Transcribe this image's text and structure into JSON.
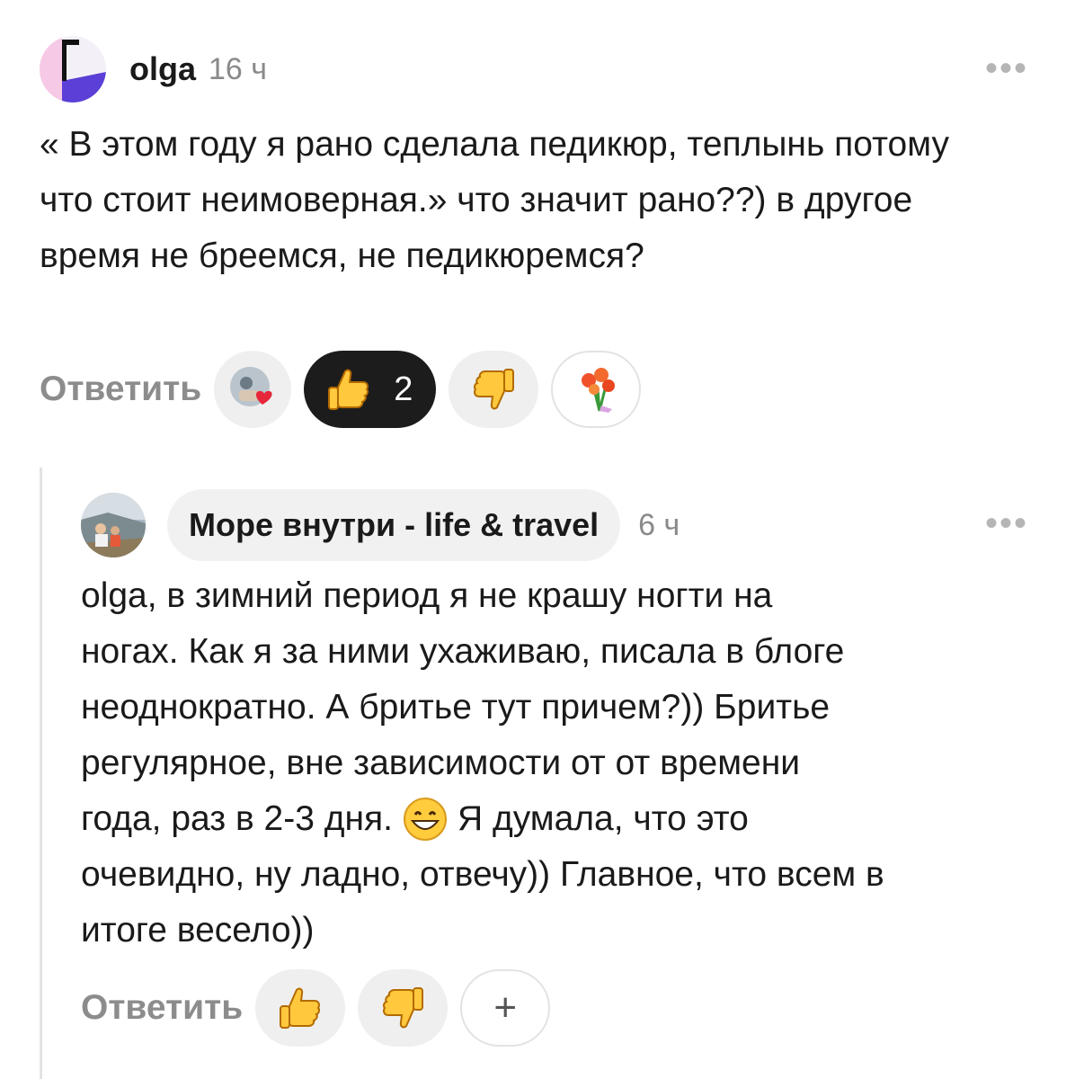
{
  "comment1": {
    "author": "olga",
    "time": "16 ч",
    "more_label": "•••",
    "text": "« В этом году я рано сделала педикюр, теплынь потому что стоит неимоверная.» что значит рано??) в другое время не бреемся, не педикюремся?",
    "reply_label": "Ответить",
    "reactions": [
      {
        "icon": "avatar-heart-reaction-icon"
      },
      {
        "icon": "thumbs-up-icon",
        "count": "2",
        "active": true
      },
      {
        "icon": "thumbs-down-icon"
      },
      {
        "icon": "flower-bouquet-icon"
      }
    ]
  },
  "comment2": {
    "author": "Море внутри - life & travel",
    "time": "6 ч",
    "more_label": "•••",
    "text_lines": [
      "olga, в зимний период я не крашу ногти на",
      "ногах. Как я за ними ухаживаю, писала в блоге",
      "неоднократно. А бритье тут причем?)) Бритье",
      "регулярное, вне зависимости от от времени",
      "года, раз в 2-3 дня.",
      "Я думала, что это",
      "очевидно, ну ладно, отвечу)) Главное, что всем в",
      "итоге весело))"
    ],
    "reply_label": "Ответить",
    "add_label": "+"
  },
  "colors": {
    "accent_dark": "#1c1c1c",
    "pill_bg": "#efefef",
    "muted_text": "#8c8c8c"
  }
}
